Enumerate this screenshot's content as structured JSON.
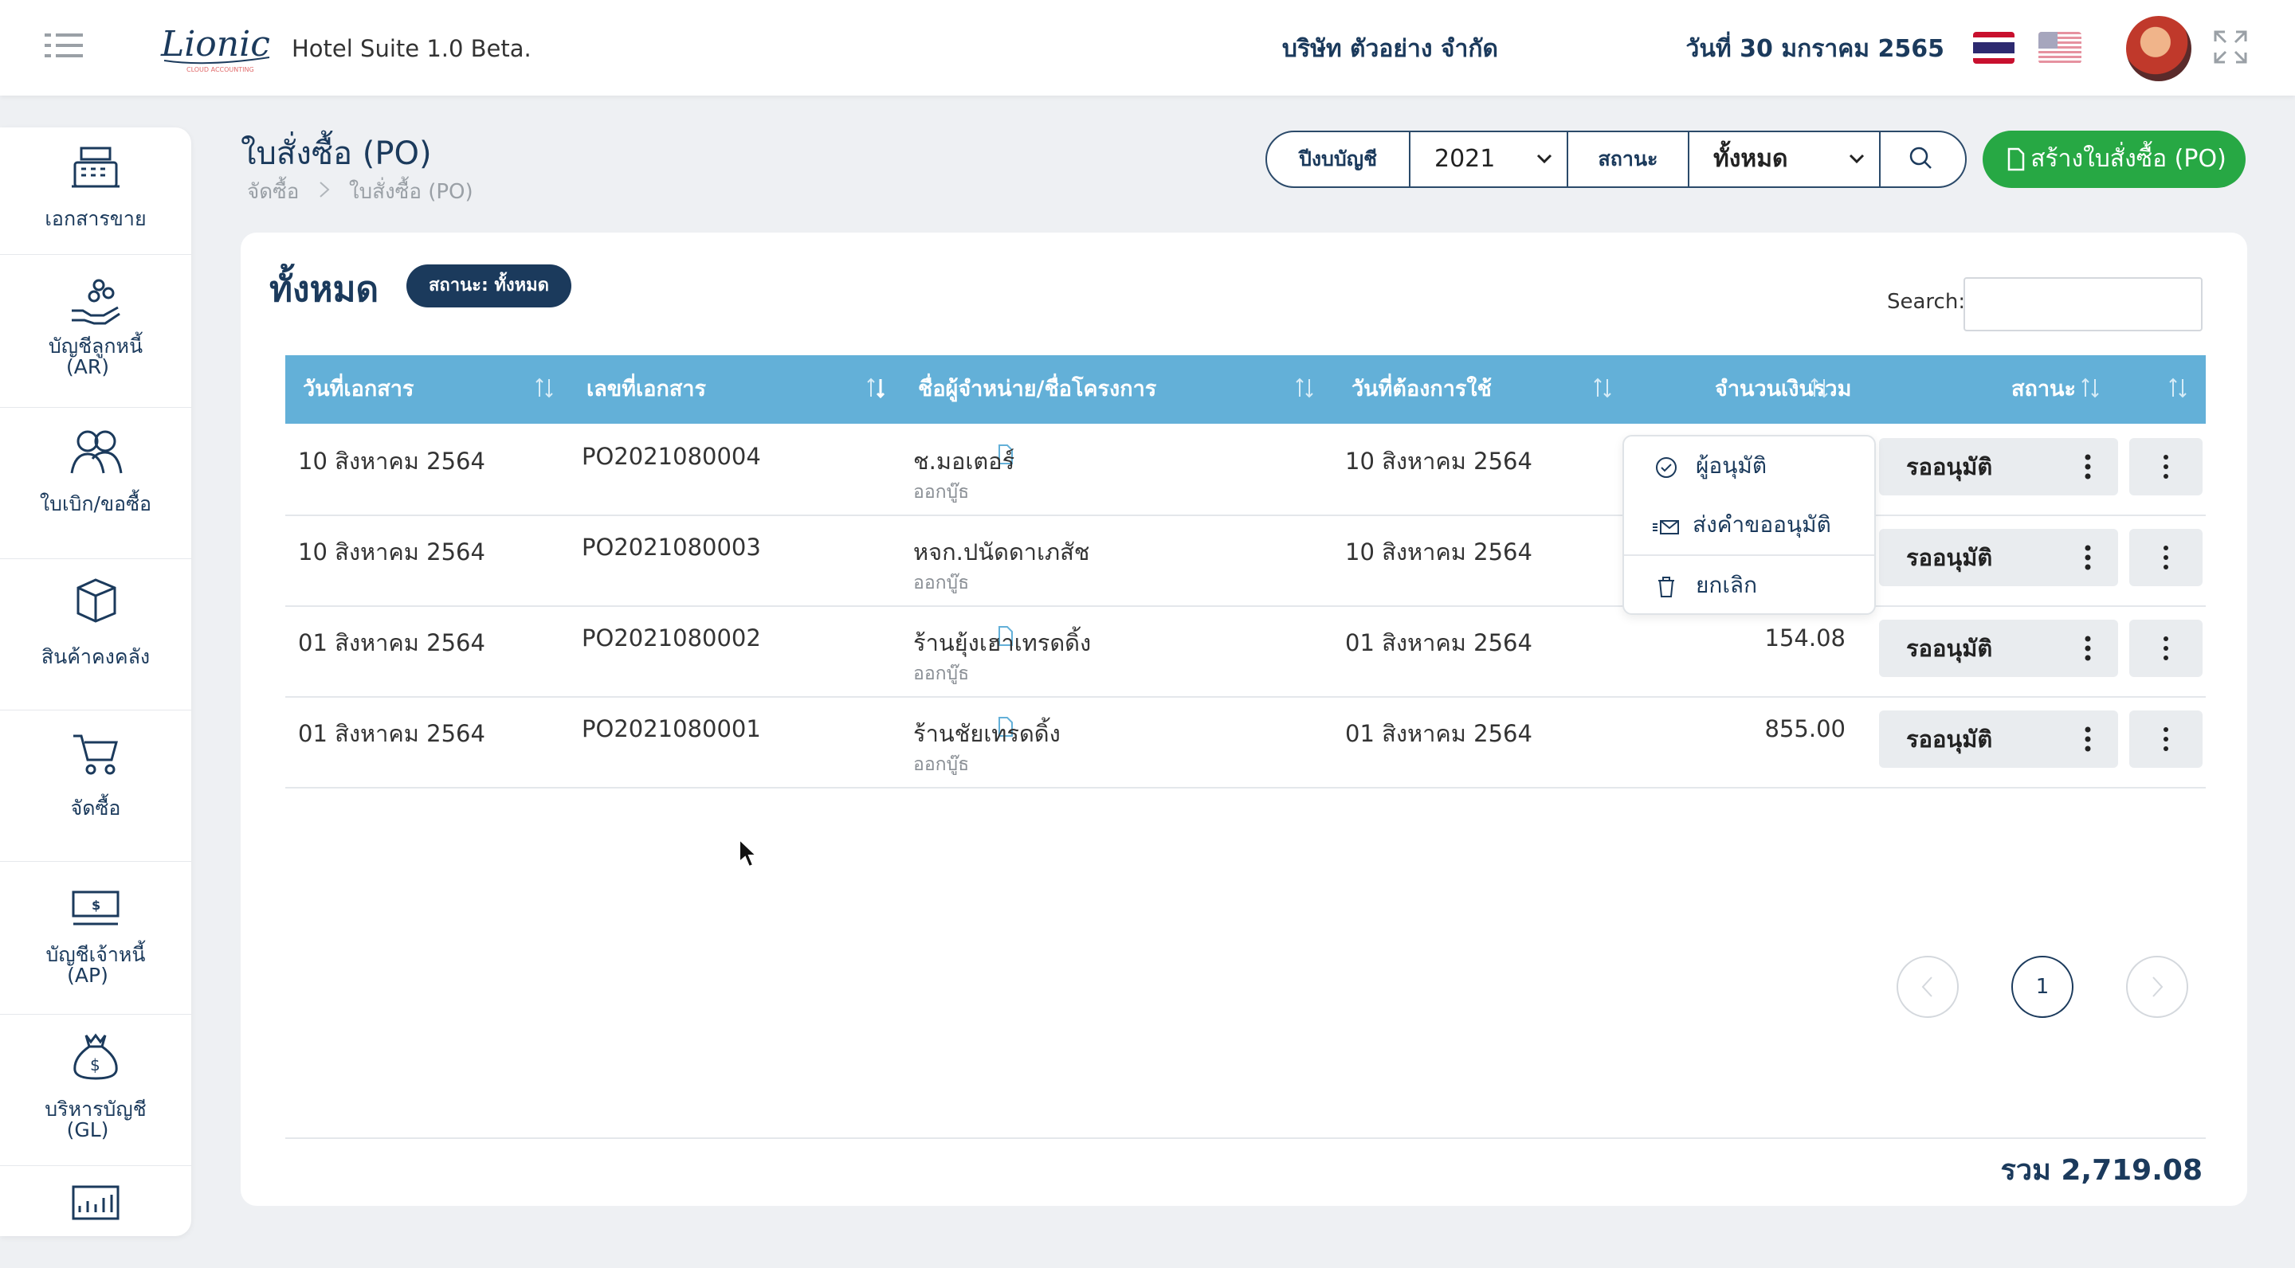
{
  "app": {
    "title": "Hotel Suite 1.0 Beta.",
    "logo_text": "Lionic",
    "logo_sub": "CLOUD ACCOUNTING"
  },
  "header": {
    "company": "บริษัท ตัวอย่าง จำกัด",
    "date": "วันที่ 30 มกราคม 2565"
  },
  "sidebar": {
    "items": [
      {
        "label": "เอกสารขาย",
        "icon": "cash-register-icon"
      },
      {
        "label": "บัญชีลูกหนี้",
        "label2": "(AR)",
        "icon": "hand-coins-icon"
      },
      {
        "label": "ใบเบิก/ขอซื้อ",
        "icon": "people-icon"
      },
      {
        "label": "สินค้าคงคลัง",
        "icon": "box-icon"
      },
      {
        "label": "จัดซื้อ",
        "icon": "cart-icon"
      },
      {
        "label": "บัญชีเจ้าหนี้",
        "label2": "(AP)",
        "icon": "banknote-icon"
      },
      {
        "label": "บริหารบัญชี",
        "label2": "(GL)",
        "icon": "money-bag-icon"
      },
      {
        "label": "",
        "icon": "chart-icon"
      }
    ]
  },
  "page": {
    "title": "ใบสั่งซื้อ (PO)",
    "breadcrumb": [
      "จัดซื้อ",
      "ใบสั่งซื้อ (PO)"
    ]
  },
  "filter": {
    "year_label": "ปีงบบัญชี",
    "year_value": "2021",
    "status_label": "สถานะ",
    "status_value": "ทั้งหมด"
  },
  "create_button": "สร้างใบสั่งซื้อ (PO)",
  "card": {
    "title": "ทั้งหมด",
    "status_pill": "สถานะ: ทั้งหมด",
    "search_label": "Search:",
    "search_value": ""
  },
  "table": {
    "headers": [
      "วันที่เอกสาร",
      "เลขที่เอกสาร",
      "ชื่อผู้จำหน่าย/ชื่อโครงการ",
      "วันที่ต้องการใช้",
      "จำนวนเงินรวม",
      "สถานะ"
    ],
    "rows": [
      {
        "doc_date": "10 สิงหาคม 2564",
        "doc_no": "PO2021080004",
        "vendor": "ช.มอเตอร์",
        "sub": "ออกบู๊ธ",
        "need_date": "10 สิงหาคม 2564",
        "amount": "",
        "status": "รออนุมัติ",
        "has_clip": true
      },
      {
        "doc_date": "10 สิงหาคม 2564",
        "doc_no": "PO2021080003",
        "vendor": "หจก.ปนัดดาเภสัช",
        "sub": "ออกบู๊ธ",
        "need_date": "10 สิงหาคม 2564",
        "amount": "",
        "status": "รออนุมัติ",
        "has_clip": false
      },
      {
        "doc_date": "01 สิงหาคม 2564",
        "doc_no": "PO2021080002",
        "vendor": "ร้านยุ้งเฮาเทรดดิ้ง",
        "sub": "ออกบู๊ธ",
        "need_date": "01 สิงหาคม 2564",
        "amount": "154.08",
        "status": "รออนุมัติ",
        "has_clip": true
      },
      {
        "doc_date": "01 สิงหาคม 2564",
        "doc_no": "PO2021080001",
        "vendor": "ร้านชัยเทรดดิ้ง",
        "sub": "ออกบู๊ธ",
        "need_date": "01 สิงหาคม 2564",
        "amount": "855.00",
        "status": "รออนุมัติ",
        "has_clip": true
      }
    ]
  },
  "dropdown": {
    "items": [
      {
        "label": "ผู้อนุมัติ",
        "icon": "check-circle-icon"
      },
      {
        "label": "ส่งคำขออนุมัติ",
        "icon": "send-mail-icon"
      },
      {
        "label": "ยกเลิก",
        "icon": "trash-icon"
      }
    ]
  },
  "pagination": {
    "current": "1"
  },
  "total": "รวม 2,719.08",
  "colors": {
    "primary": "#1b3a5c",
    "table_header": "#63b0d8",
    "create_green": "#27a844",
    "background": "#eef0f3"
  }
}
